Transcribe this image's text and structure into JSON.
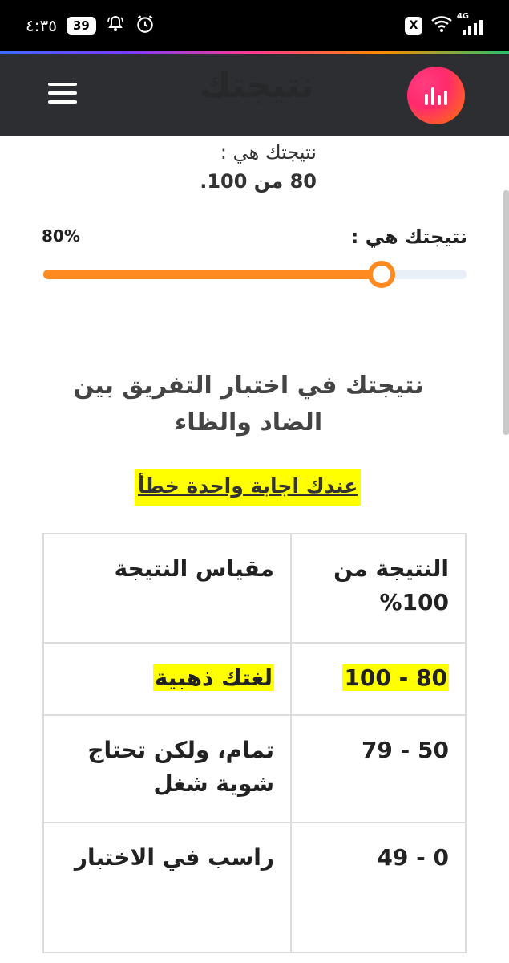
{
  "status_bar": {
    "time": "٤:٣٥",
    "badge": "39",
    "network": "4G"
  },
  "header": {
    "title": "نتيجتك"
  },
  "result": {
    "line1": "نتيجتك هي :",
    "line2": "80 من 100."
  },
  "progress": {
    "label": "نتيجتك هي :",
    "percent_text": "80%",
    "value_fraction": 0.8
  },
  "section": {
    "title": "نتيجتك في اختبار التفريق بين الضاد والظاء",
    "note": "عندك اجابة واحدة خطأ"
  },
  "table": {
    "headers": [
      "النتيجة من 100%",
      "مقياس النتيجة"
    ],
    "rows": [
      {
        "range": "80 - 100",
        "label": "لغتك ذهبية"
      },
      {
        "range": "50 - 79",
        "label": "تمام، ولكن تحتاج شوية شغل"
      },
      {
        "range": "0 - 49",
        "label": "راسب في الاختبار"
      }
    ]
  },
  "colors": {
    "header_bg": "#2c2e31",
    "accent": "#ff8a1f",
    "highlight": "#ffff00"
  }
}
